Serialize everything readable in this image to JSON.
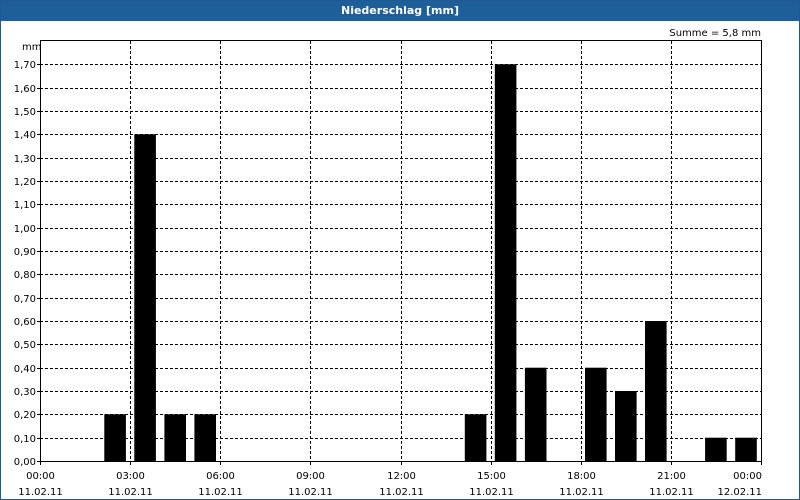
{
  "window": {
    "title": "Niederschlag [mm]"
  },
  "chart_data": {
    "type": "bar",
    "title": "Niederschlag [mm]",
    "ylabel": "mm",
    "summary": "Summe = 5,8 mm",
    "ylim": [
      0,
      1.8
    ],
    "yticks": [
      "0,00",
      "0,10",
      "0,20",
      "0,30",
      "0,40",
      "0,50",
      "0,60",
      "0,70",
      "0,80",
      "0,90",
      "1,00",
      "1,10",
      "1,20",
      "1,30",
      "1,40",
      "1,50",
      "1,60",
      "1,70"
    ],
    "xlim_hours": [
      0,
      24
    ],
    "xticks": [
      {
        "time": "00:00",
        "date": "11.02.11"
      },
      {
        "time": "03:00",
        "date": "11.02.11"
      },
      {
        "time": "06:00",
        "date": "11.02.11"
      },
      {
        "time": "09:00",
        "date": "11.02.11"
      },
      {
        "time": "12:00",
        "date": "11.02.11"
      },
      {
        "time": "15:00",
        "date": "11.02.11"
      },
      {
        "time": "18:00",
        "date": "11.02.11"
      },
      {
        "time": "21:00",
        "date": "11.02.11"
      },
      {
        "time": "00:00",
        "date": "12.02.11"
      }
    ],
    "x": [
      "02:00–03:00",
      "03:00–04:00",
      "04:00–05:00",
      "05:00–06:00",
      "14:00–15:00",
      "15:00–16:00",
      "16:00–17:00",
      "18:00–19:00",
      "19:00–20:00",
      "20:00–21:00",
      "22:00–23:00",
      "23:00–24:00"
    ],
    "bars": [
      {
        "hour": 2.5,
        "value": 0.2
      },
      {
        "hour": 3.5,
        "value": 1.4
      },
      {
        "hour": 4.5,
        "value": 0.2
      },
      {
        "hour": 5.5,
        "value": 0.2
      },
      {
        "hour": 14.5,
        "value": 0.2
      },
      {
        "hour": 15.5,
        "value": 1.7
      },
      {
        "hour": 16.5,
        "value": 0.4
      },
      {
        "hour": 18.5,
        "value": 0.4
      },
      {
        "hour": 19.5,
        "value": 0.3
      },
      {
        "hour": 20.5,
        "value": 0.6
      },
      {
        "hour": 22.5,
        "value": 0.1
      },
      {
        "hour": 23.5,
        "value": 0.1
      }
    ],
    "bar_color": "#000000",
    "grid": true
  }
}
